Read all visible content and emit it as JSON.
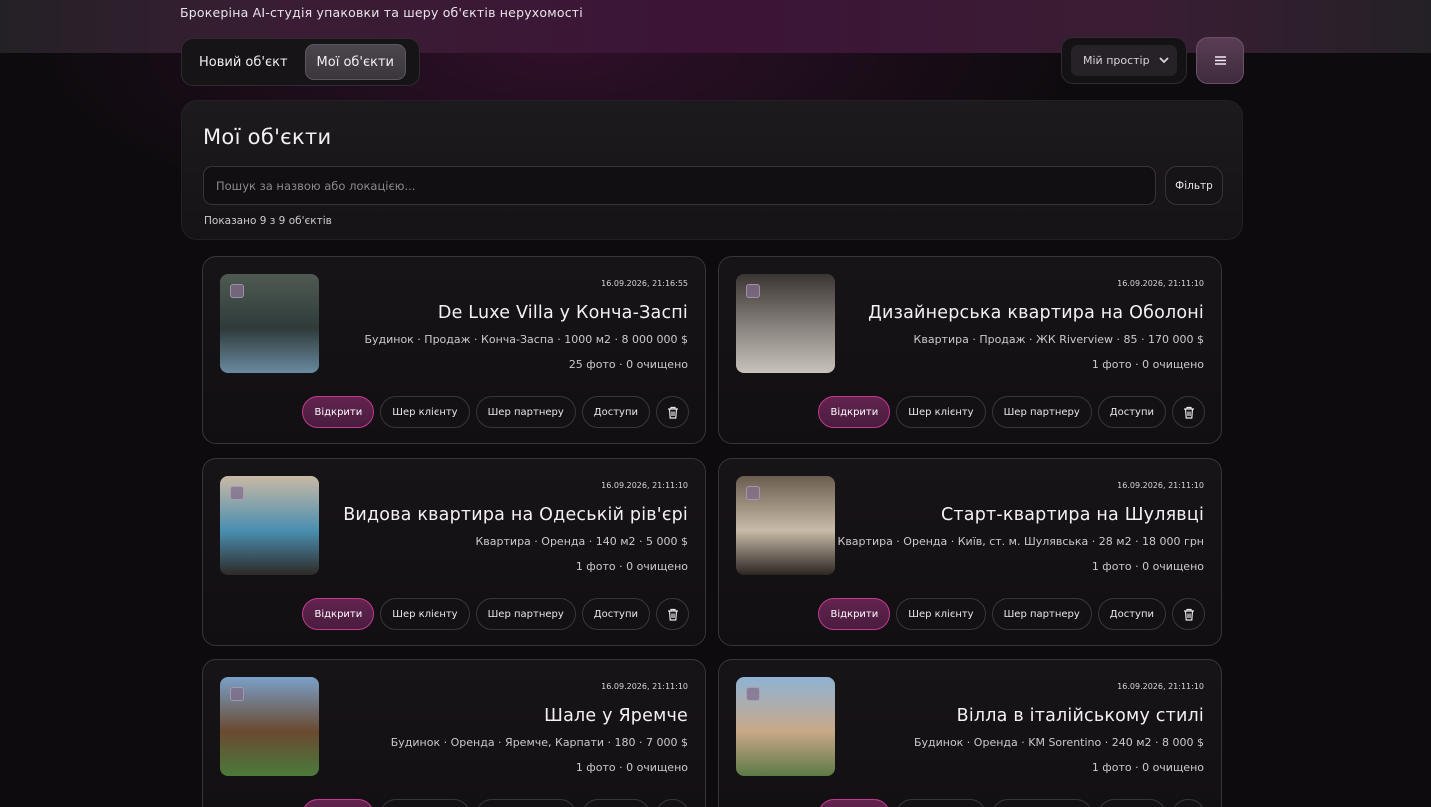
{
  "header": {
    "subtitle": "Брокеріна AI-студія упаковки та шеру об'єктів нерухомості",
    "tabs": [
      {
        "label": "Новий об'єкт",
        "active": false
      },
      {
        "label": "Мої об'єкти",
        "active": true
      }
    ],
    "space_select": {
      "value": "Мій простір"
    },
    "menu_icon": "hamburger-menu-icon"
  },
  "panel": {
    "title": "Мої об'єкти",
    "search_placeholder": "Пошук за назвою або локацією...",
    "filter_label": "Фільтр",
    "count_text": "Показано 9 з 9 об'єктів"
  },
  "actions": {
    "open": "Відкрити",
    "share_client": "Шер клієнту",
    "share_partner": "Шер партнеру",
    "access": "Доступи",
    "delete_icon": "trash-icon"
  },
  "cards": [
    {
      "date": "16.09.2026, 21:16:55",
      "title": "De Luxe Villa у Конча-Заспі",
      "meta": "Будинок · Продаж · Конча-Заспа · 1000 м2 · 8 000 000 $",
      "stats": "25 фото · 0 очищено",
      "thumb_palette": [
        "#4f5a52",
        "#2e3b3a",
        "#6a8aa0"
      ]
    },
    {
      "date": "16.09.2026, 21:11:10",
      "title": "Дизайнерська квартира на Оболоні",
      "meta": "Квартира · Продаж · ЖК Riverview · 85 · 170 000 $",
      "stats": "1 фото · 0 очищено",
      "thumb_palette": [
        "#3a3532",
        "#8b8580",
        "#c7c2bc"
      ]
    },
    {
      "date": "16.09.2026, 21:11:10",
      "title": "Видова квартира на Одеській рів'єрі",
      "meta": "Квартира · Оренда · 140 м2 · 5 000 $",
      "stats": "1 фото · 0 очищено",
      "thumb_palette": [
        "#c9b9a5",
        "#4a8fb0",
        "#2e2a27"
      ]
    },
    {
      "date": "16.09.2026, 21:11:10",
      "title": "Старт-квартира на Шулявці",
      "meta": "Квартира · Оренда · Київ, ст. м. Шулявська · 28 м2 · 18 000 грн",
      "stats": "1 фото · 0 очищено",
      "thumb_palette": [
        "#6b5d4f",
        "#c8bba8",
        "#2c2622"
      ]
    },
    {
      "date": "16.09.2026, 21:11:10",
      "title": "Шале у Яремче",
      "meta": "Будинок · Оренда · Яремче, Карпати · 180 · 7 000 $",
      "stats": "1 фото · 0 очищено",
      "thumb_palette": [
        "#7aa0c8",
        "#6a4a30",
        "#4b7a3a"
      ]
    },
    {
      "date": "16.09.2026, 21:11:10",
      "title": "Вілла в італійському стилі",
      "meta": "Будинок · Оренда · KM Sorentino · 240 м2 · 8 000 $",
      "stats": "1 фото · 0 очищено",
      "thumb_palette": [
        "#8fb3d4",
        "#c9a888",
        "#5d7a45"
      ]
    }
  ],
  "colors": {
    "accent": "#c23a8e",
    "background": "#0d0b0e"
  }
}
